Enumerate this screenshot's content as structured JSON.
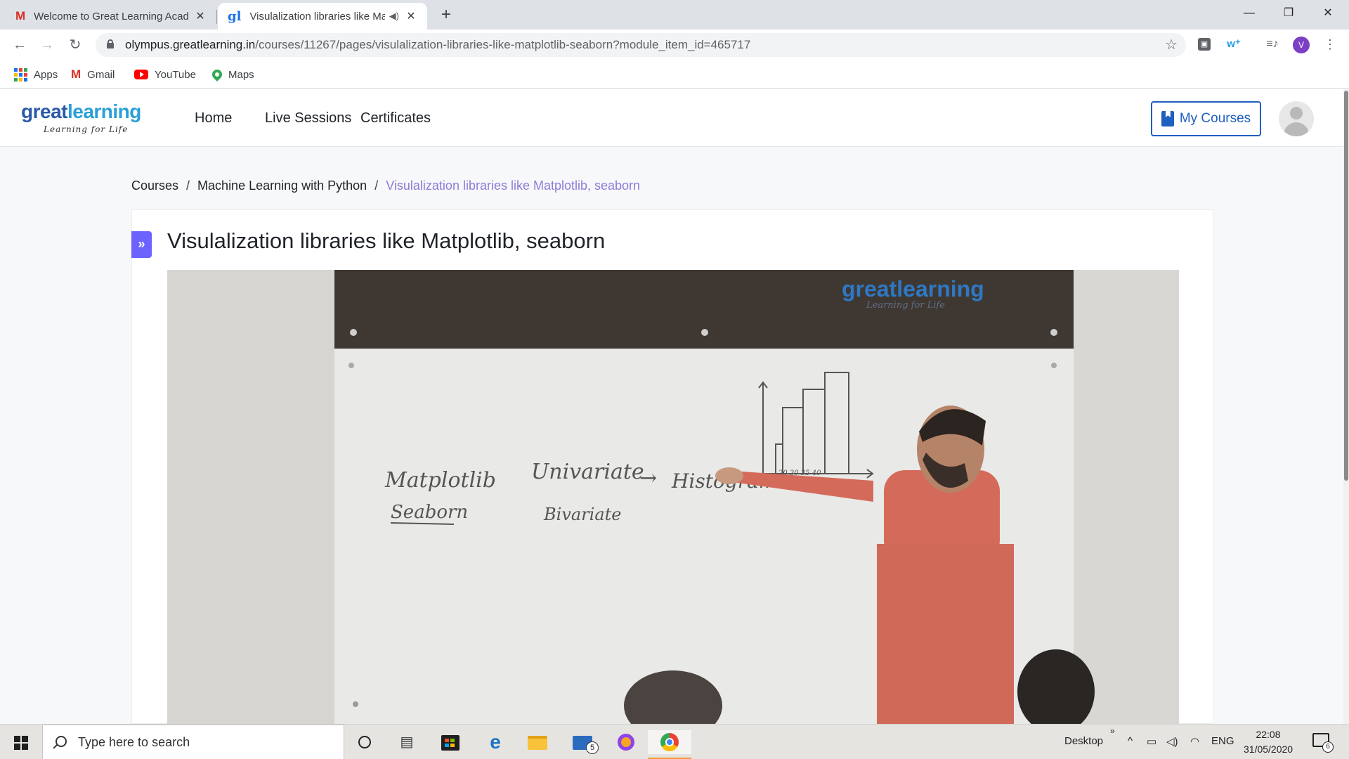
{
  "browser": {
    "tabs": [
      {
        "title": "Welcome to Great Learning Academy",
        "active": false,
        "favicon": "gmail-icon"
      },
      {
        "title": "Visulalization libraries like Matplotlib, seaborn",
        "active": true,
        "favicon": "greatlearning-icon",
        "audio": true
      }
    ],
    "new_tab_glyph": "+",
    "window_controls": {
      "minimize": "—",
      "restore": "❐",
      "close": "✕"
    },
    "url_domain": "olympus.greatlearning.in",
    "url_path": "/courses/11267/pages/visulalization-libraries-like-matplotlib-seaborn?module_item_id=465717",
    "profile_initial": "V",
    "bookmarks": [
      {
        "label": "Apps",
        "icon": "apps-grid-icon"
      },
      {
        "label": "Gmail",
        "icon": "gmail-icon"
      },
      {
        "label": "YouTube",
        "icon": "youtube-icon"
      },
      {
        "label": "Maps",
        "icon": "maps-icon"
      }
    ]
  },
  "site": {
    "logo_main_a": "great",
    "logo_main_b": "learning",
    "logo_tagline": "Learning for Life",
    "nav": [
      "Home",
      "Live Sessions",
      "Certificates"
    ],
    "my_courses_label": "My Courses",
    "brand_color": "#1f5fbf"
  },
  "breadcrumb": {
    "items": [
      "Courses",
      "Machine Learning with Python"
    ],
    "current": "Visulalization libraries like Matplotlib, seaborn",
    "separator": "/"
  },
  "page": {
    "expand_glyph": "»",
    "title": "Visulalization libraries like Matplotlib, seaborn"
  },
  "video": {
    "watermark_main": "greatlearning",
    "watermark_tagline": "Learning for Life",
    "whiteboard": {
      "matplotlib": "Matplotlib",
      "seaborn": "Seaborn",
      "univariate": "Univariate",
      "arrow": "→",
      "histogram": "Histogram",
      "bivariate": "Bivariate",
      "axis_ticks": "20 30 35 40"
    }
  },
  "taskbar": {
    "search_placeholder": "Type here to search",
    "mail_badge": "5",
    "desktop_label": "Desktop",
    "language": "ENG",
    "time": "22:08",
    "date": "31/05/2020",
    "notification_count": "6"
  }
}
